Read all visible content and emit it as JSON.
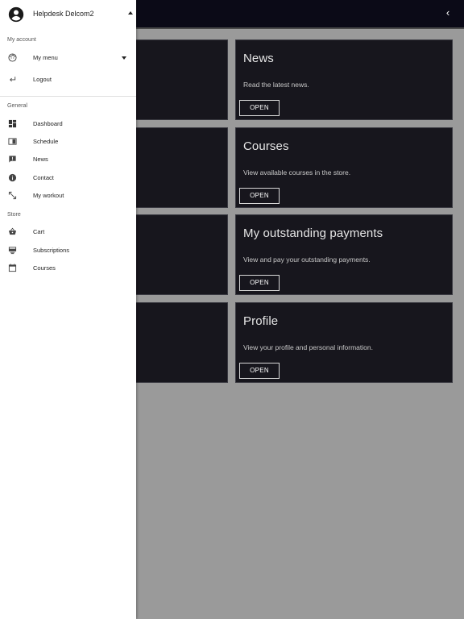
{
  "drawer": {
    "user_name": "Helpdesk Delcom2",
    "sections": {
      "account": "My account",
      "general": "General",
      "store": "Store"
    },
    "account_items": [
      {
        "label": "My menu",
        "icon": "face-icon"
      },
      {
        "label": "Logout",
        "icon": "logout-arrow-icon"
      }
    ],
    "general_items": [
      {
        "label": "Dashboard",
        "icon": "dashboard-icon"
      },
      {
        "label": "Schedule",
        "icon": "schedule-icon"
      },
      {
        "label": "News",
        "icon": "announcement-icon"
      },
      {
        "label": "Contact",
        "icon": "info-icon"
      },
      {
        "label": "My workout",
        "icon": "resize-arrows-icon"
      }
    ],
    "store_items": [
      {
        "label": "Cart",
        "icon": "basket-icon"
      },
      {
        "label": "Subscriptions",
        "icon": "subscriptions-icon"
      },
      {
        "label": "Courses",
        "icon": "calendar-icon"
      }
    ]
  },
  "cards": [
    {
      "title": "News",
      "description": "Read the latest news.",
      "button": "OPEN"
    },
    {
      "title": "Courses",
      "description": "View available courses in the store.",
      "button": "OPEN"
    },
    {
      "title": "My outstanding payments",
      "description": "View and pay your outstanding payments.",
      "button": "OPEN"
    },
    {
      "title": "Profile",
      "description": "View your profile and personal information.",
      "button": "OPEN"
    }
  ],
  "colors": {
    "topbar": "#0b0a17",
    "card_bg": "#17161d",
    "overlay_bg": "#9a9a9a",
    "drawer_bg": "#ffffff"
  }
}
